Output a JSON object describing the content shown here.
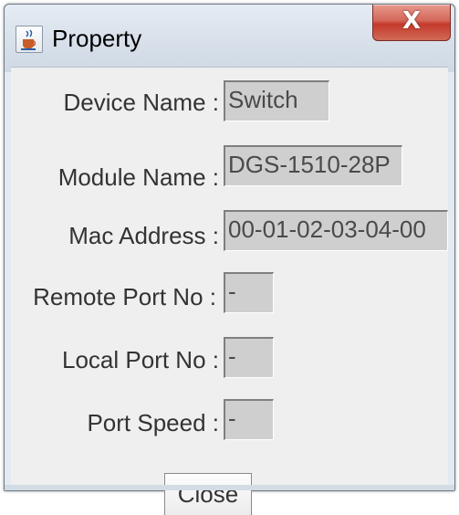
{
  "window": {
    "title": "Property",
    "app_icon": "java-cup-icon",
    "close_glyph": "X"
  },
  "fields": [
    {
      "label": "Device Name :",
      "value": "Switch"
    },
    {
      "label": "Module Name :",
      "value": "DGS-1510-28P"
    },
    {
      "label": "Mac Address :",
      "value": "00-01-02-03-04-00"
    },
    {
      "label": "Remote Port No :",
      "value": "-"
    },
    {
      "label": "Local Port No :",
      "value": "-"
    },
    {
      "label": "Port Speed :",
      "value": "-"
    }
  ],
  "buttons": {
    "close_label": "Close"
  },
  "colors": {
    "titlebar_close": "#c4392a",
    "field_background": "#cfcfcf",
    "dialog_background": "#efefef"
  }
}
